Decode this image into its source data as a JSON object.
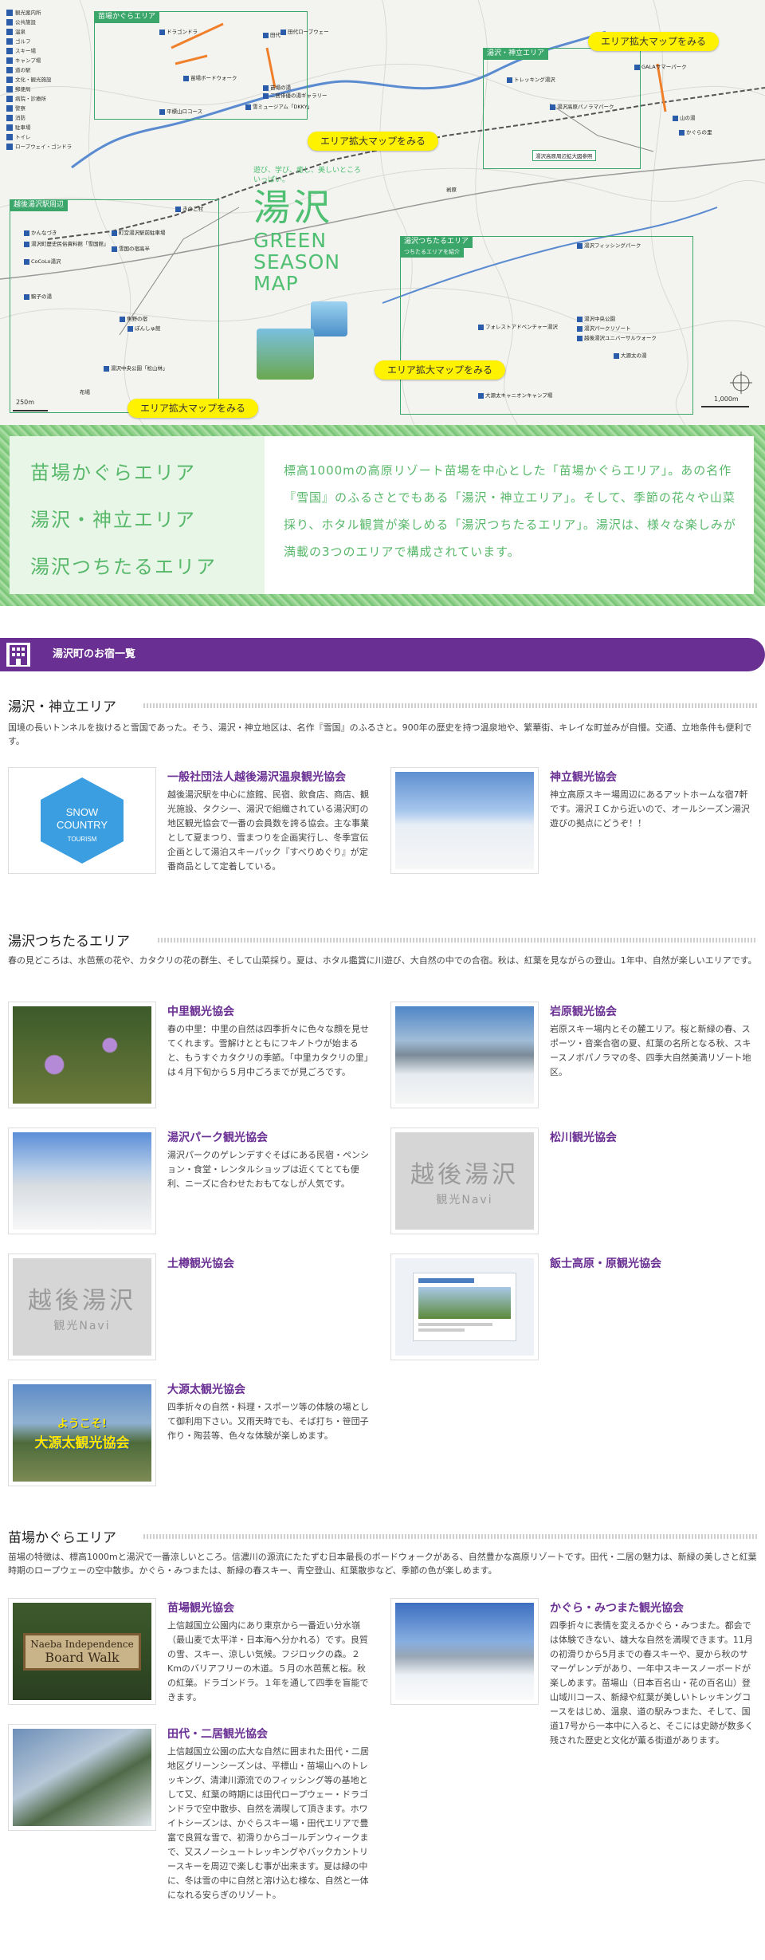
{
  "map": {
    "legend": [
      "観光案内所",
      "公共施設",
      "温泉",
      "ゴルフ",
      "スキー場",
      "キャンプ場",
      "道の駅",
      "文化・観光施設",
      "郵便局",
      "病院・診療所",
      "警察",
      "消防",
      "駐車場",
      "トイレ",
      "ロープウェイ・ゴンドラ"
    ],
    "area_labels": {
      "naeba": "苗場かぐらエリア",
      "yuzawa": "湯沢・神立エリア",
      "station": "越後湯沢駅周辺",
      "tsuchitaru": "湯沢つちたるエリア"
    },
    "tsuchitaru_sub": "つちたるエリアを紹介",
    "expand_button": "エリア拡大マップをみる",
    "tag": "遊び、学び、癒し、美しいところいっぱい。",
    "title_kanji": "湯沢",
    "title_line1": "GREEN",
    "title_line2": "SEASON",
    "title_line3": "MAP",
    "scale_label": "1,000m",
    "scale_label_small": "250m",
    "expand_label": "湯沢高原周辺拡大図参照",
    "poi": [
      "ドラゴンドラ",
      "田代ロープウェー",
      "苗場ボードウォーク",
      "平標山ロコース",
      "雪ミュージアム「DKKY」",
      "苗場の湯",
      "二居俳優の湯ギャラリー",
      "トレッキング湯沢",
      "GALAサマーパーク",
      "湯沢高原パノラマパーク",
      "山の湯",
      "かぐらの里",
      "きのこ村",
      "田代",
      "湯沢フィッシングパーク",
      "湯沢中央公園",
      "湯沢パークリゾート",
      "越後湯沢ユニバーサルウォーク",
      "大源太キャニオンキャンプ場",
      "フォレストアドベンチャー湯沢",
      "かんなづき",
      "CoCoLo湯沢",
      "ぽんしゅ館",
      "湯沢中央公園「松山林」",
      "湯沢町歴史民俗資料館「雪国館」",
      "町営湯沢駅前駐車場",
      "駒子の湯",
      "雪国の宿高半",
      "魚野の宿",
      "布場",
      "大源太の湯",
      "岩原"
    ]
  },
  "banner": {
    "areas": [
      "苗場かぐらエリア",
      "湯沢・神立エリア",
      "湯沢つちたるエリア"
    ],
    "description": "標高1000mの高原リゾート苗場を中心とした「苗場かぐらエリア」。あの名作『雪国』のふるさとでもある「湯沢・神立エリア」。そして、季節の花々や山菜採り、ホタル観賞が楽しめる「湯沢つちたるエリア」。湯沢は、様々な楽しみが満載の3つのエリアで構成されています。"
  },
  "header": {
    "title": "湯沢町のお宿一覧"
  },
  "sections": [
    {
      "title": "湯沢・神立エリア",
      "desc": "国境の長いトンネルを抜けると雪国であった。そう、湯沢・神立地区は、名作『雪国』のふるさと。900年の歴史を持つ温泉地や、繁華街、キレイな町並みが自慢。交通、立地条件も便利です。",
      "cards": [
        {
          "name": "一般社団法人越後湯沢温泉観光協会",
          "text": "越後湯沢駅を中心に旅館、民宿、飲食店、商店、観光施設、タクシー、湯沢で組織されている湯沢町の地区観光協会で一番の会員数を誇る協会。主な事業として夏まつり、雪まつりを企画実行し、冬季宣伝企画として湯泊スキーパック『すべりめぐり』が定番商品として定着している。",
          "logo_line1": "SNOW",
          "logo_line2": "COUNTRY",
          "logo_line3": "TOURISM"
        },
        {
          "name": "神立観光協会",
          "text": "神立高原スキー場周辺にあるアットホームな宿7軒です。湯沢ＩＣから近いので、オールシーズン湯沢遊びの拠点にどうぞ！！"
        }
      ]
    },
    {
      "title": "湯沢つちたるエリア",
      "desc": "春の見どころは、水芭蕉の花や、カタクリの花の群生、そして山菜採り。夏は、ホタル鑑賞に川遊び、大自然の中での合宿。秋は、紅葉を見ながらの登山。1年中、自然が楽しいエリアです。",
      "cards": [
        {
          "name": "中里観光協会",
          "text": "春の中里：中里の自然は四季折々に色々な顔を見せてくれます。雪解けとともにフキノトウが始まると、もうすぐカタクリの季節。「中里カタクリの里」は４月下旬から５月中ごろまでが見ごろです。"
        },
        {
          "name": "岩原観光協会",
          "text": "岩原スキー場内とその麓エリア。桜と新緑の春、スポーツ・音楽合宿の夏、紅葉の名所となる秋、スキースノボパノラマの冬、四季大自然美満リゾート地区。"
        },
        {
          "name": "湯沢パーク観光協会",
          "text": "湯沢パークのゲレンデすぐそばにある民宿・ペンション・食堂・レンタルショップは近くてとても便利、ニーズに合わせたおもてなしが人気です。"
        },
        {
          "name": "松川観光協会",
          "text": "",
          "navi1": "越後湯沢",
          "navi2": "観光Navi"
        },
        {
          "name": "土樽観光協会",
          "text": "",
          "navi1": "越後湯沢",
          "navi2": "観光Navi"
        },
        {
          "name": "飯士高原・原観光協会",
          "text": ""
        },
        {
          "name": "大源太観光協会",
          "text": "四季折々の自然・料理・スポーツ等の体験の場として御利用下さい。又雨天時でも、そば打ち・笹団子作り・陶芸等、色々な体験が楽しめます。",
          "badge1": "ようこそ!",
          "badge2": "大源太観光協会"
        }
      ]
    },
    {
      "title": "苗場かぐらエリア",
      "desc": "苗場の特徴は、標高1000mと湯沢で一番涼しいところ。信濃川の源流にたたずむ日本最長のボードウォークがある、自然豊かな高原リゾートです。田代・二居の魅力は、新緑の美しさと紅葉時期のロープウェーの空中散歩。かぐら・みつまたは、新緑の春スキー、青空登山、紅葉散歩など、季節の色が楽しめます。",
      "cards": [
        {
          "name": "苗場観光協会",
          "text": "上信越国立公園内にあり東京から一番近い分水嶺（最山麦で太平洋・日本海へ分かれる）です。良質の雪、スキー、涼しい気候。フジロックの森。２Kmのバリアフリーの木道。５月の水芭蕉と桜。秋の紅葉。ドラゴンドラ。１年を通して四季を盲能できます。",
          "board1": "Naeba Independence",
          "board2": "Board Walk"
        },
        {
          "name": "かぐら・みつまた観光協会",
          "text": "四季折々に表情を変えるかぐら・みつまた。都会では体験できない、雄大な自然を満喫できます。11月の初滑りから5月までの春スキーや、夏から秋のサマーゲレンデがあり、一年中スキースノーボードが楽しめます。苗場山（日本百名山・花の百名山）登山域川コース、新緑や紅葉が美しいトレッキングコースをはじめ、温泉、道の駅みつまた、そして、国道17号から一本中に入ると、そこには史跡が数多く残された歴史と文化が薫る街道があります。"
        },
        {
          "name": "田代・二居観光協会",
          "text": "上信越国立公園の広大な自然に囲まれた田代・二居地区グリーンシーズンは、平標山・苗場山へのトレッキング、清津川源流でのフィッシング等の基地として又、紅葉の時期には田代ロープウェー・ドラゴンドラで空中散歩、自然を満喫して頂きます。ホワイトシーズンは、かぐらスキー場・田代エリアで豊富で良質な雪で、初滑りからゴールデンウィークまで、又スノーシュートレッキングやバックカントリースキーを周辺で楽しむ事が出来ます。夏は緑の中に、冬は雪の中に自然と溶け込む様な、自然と一体になれる安らぎのリゾート。"
        }
      ]
    }
  ]
}
